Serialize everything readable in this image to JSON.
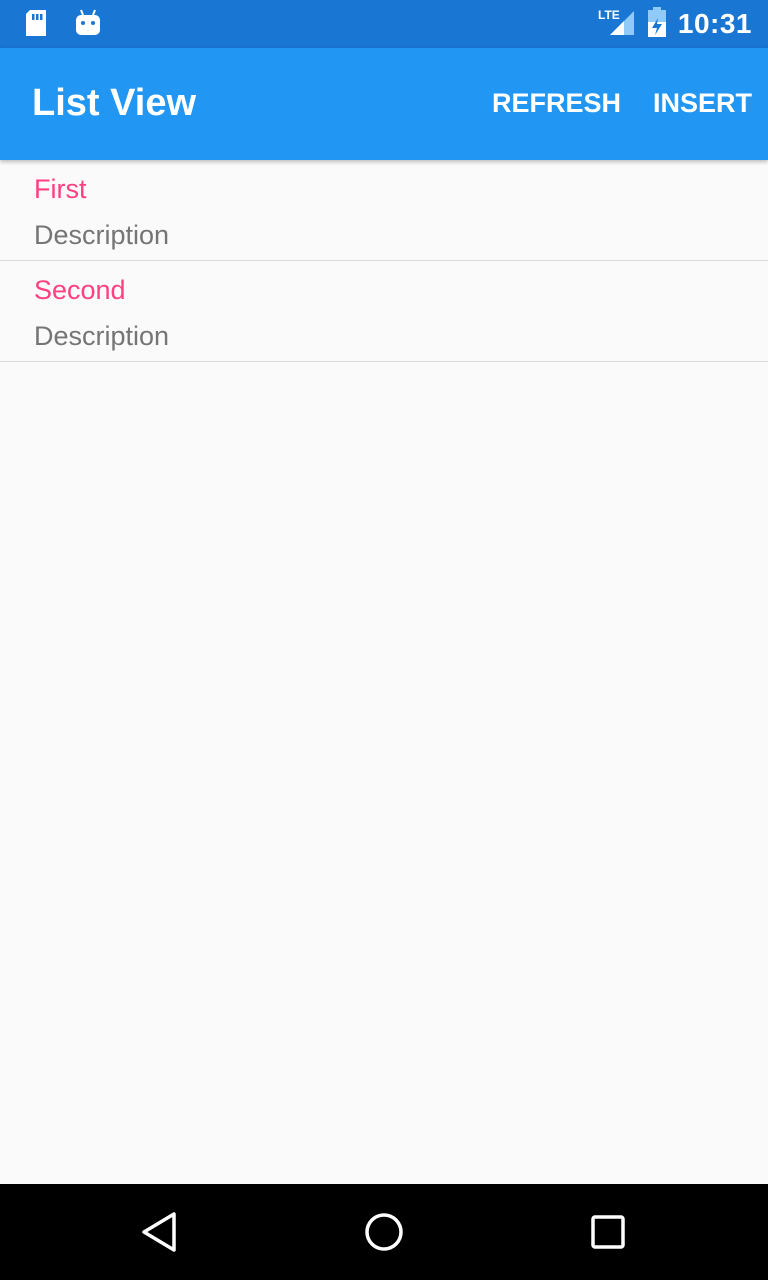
{
  "status_bar": {
    "time": "10:31",
    "network": "LTE",
    "icons": [
      "sd-card-icon",
      "android-icon",
      "lte-signal-icon",
      "battery-icon"
    ]
  },
  "app_bar": {
    "title": "List View",
    "actions": [
      {
        "label": "REFRESH"
      },
      {
        "label": "INSERT"
      }
    ]
  },
  "list": {
    "items": [
      {
        "title": "First",
        "description": "Description"
      },
      {
        "title": "Second",
        "description": "Description"
      }
    ]
  },
  "colors": {
    "status_bar": "#1976d2",
    "app_bar": "#2196f3",
    "item_title": "#ff4081",
    "item_desc": "#757575",
    "background": "#fafafa"
  },
  "nav_bar": {
    "buttons": [
      "back-icon",
      "home-icon",
      "recents-icon"
    ]
  }
}
